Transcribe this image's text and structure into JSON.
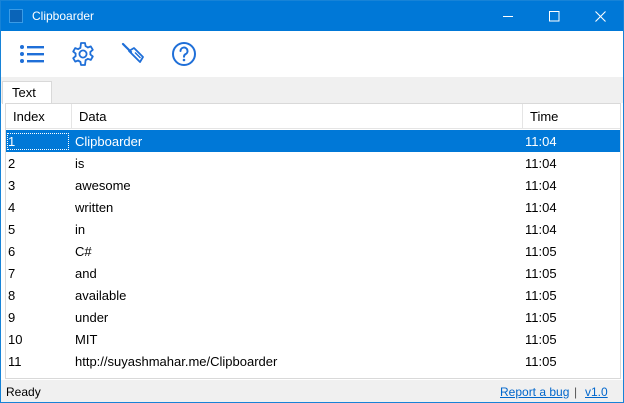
{
  "window": {
    "title": "Clipboarder"
  },
  "toolbar": {
    "items": [
      {
        "icon": "list-icon",
        "label": "History"
      },
      {
        "icon": "gear-icon",
        "label": "Settings"
      },
      {
        "icon": "broom-icon",
        "label": "Clear"
      },
      {
        "icon": "help-icon",
        "label": "Help"
      }
    ]
  },
  "tabs": [
    {
      "label": "Text"
    }
  ],
  "table": {
    "columns": [
      "Index",
      "Data",
      "Time"
    ],
    "rows": [
      {
        "index": "1",
        "data": "Clipboarder",
        "time": "11:04",
        "selected": true
      },
      {
        "index": "2",
        "data": "is",
        "time": "11:04"
      },
      {
        "index": "3",
        "data": "awesome",
        "time": "11:04"
      },
      {
        "index": "4",
        "data": "written",
        "time": "11:04"
      },
      {
        "index": "5",
        "data": "in",
        "time": "11:04"
      },
      {
        "index": "6",
        "data": "C#",
        "time": "11:05"
      },
      {
        "index": "7",
        "data": "and",
        "time": "11:05"
      },
      {
        "index": "8",
        "data": "available",
        "time": "11:05"
      },
      {
        "index": "9",
        "data": "under",
        "time": "11:05"
      },
      {
        "index": "10",
        "data": "MIT",
        "time": "11:05"
      },
      {
        "index": "11",
        "data": "http://suyashmahar.me/Clipboarder",
        "time": "11:05"
      }
    ]
  },
  "status": {
    "text": "Ready",
    "bug_link": "Report a bug",
    "separator": "|",
    "version": "v1.0"
  },
  "colors": {
    "accent": "#0078d7",
    "icon_blue": "#1f6fd8",
    "selection": "#0078d7"
  }
}
